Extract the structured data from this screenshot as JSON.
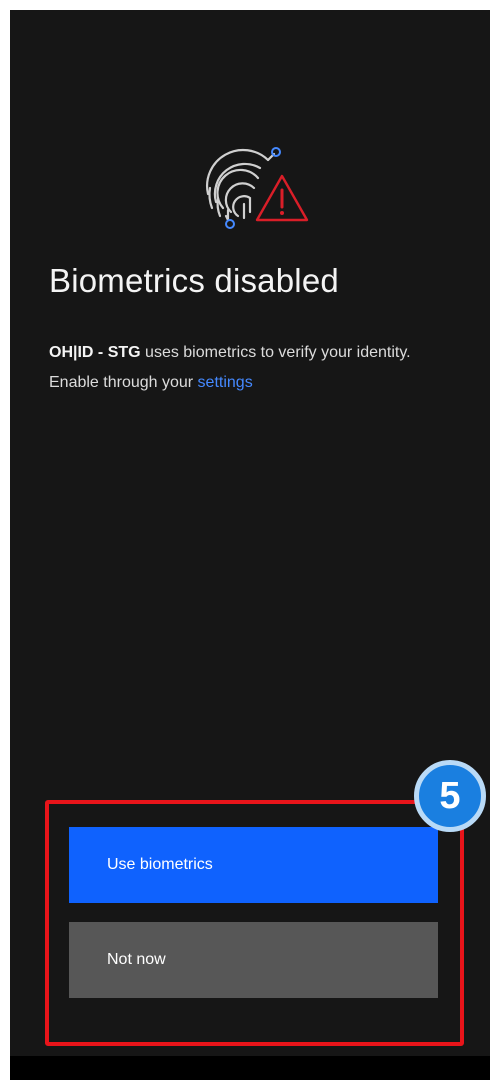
{
  "screen": {
    "title": "Biometrics disabled",
    "description": {
      "app_name": "OH|ID - STG",
      "text_before_link": " uses biometrics to verify your identity. Enable through your ",
      "link_label": "settings"
    }
  },
  "actions": {
    "primary_label": "Use biometrics",
    "secondary_label": "Not now"
  },
  "annotation": {
    "step_number": "5"
  },
  "icons": {
    "status_icon": "fingerprint-warning-icon"
  },
  "colors": {
    "background": "#161616",
    "primary_button": "#0f62fe",
    "secondary_button": "#575757",
    "link": "#4589ff",
    "warning": "#da1e28",
    "highlight": "#e8141a",
    "badge": "#1a7fe0"
  }
}
